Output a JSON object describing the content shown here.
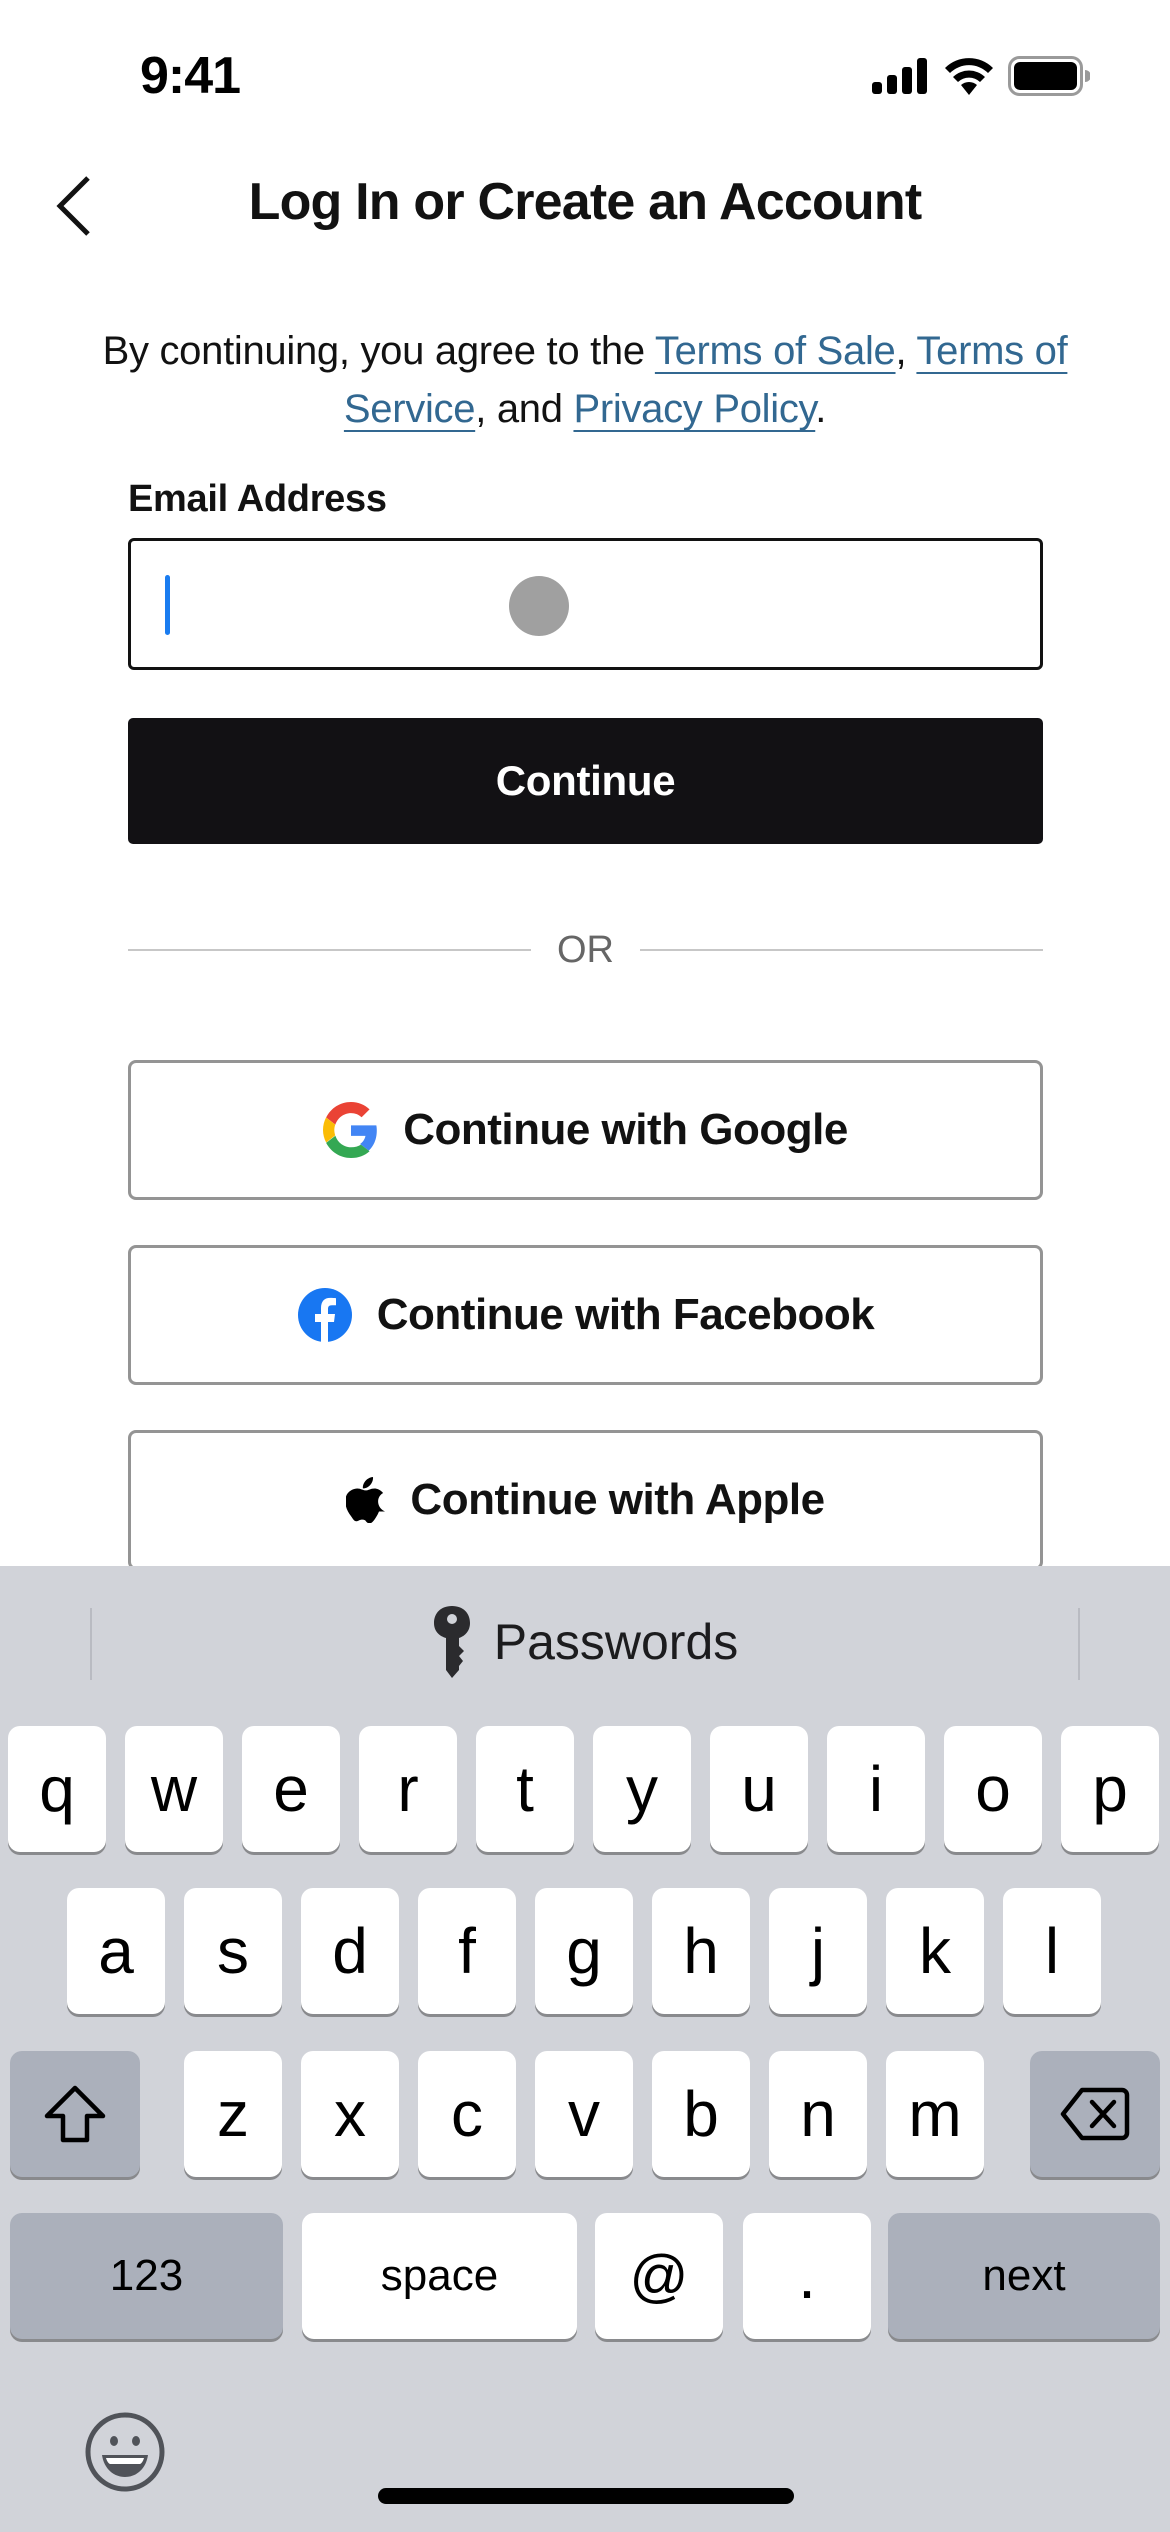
{
  "status_bar": {
    "time": "9:41",
    "icons": [
      "cellular-signal-icon",
      "wifi-icon",
      "battery-icon"
    ]
  },
  "header": {
    "back_icon": "chevron-left-icon",
    "title": "Log In or Create an Account"
  },
  "terms": {
    "prefix": "By continuing, you agree to the ",
    "terms_of_sale": "Terms of Sale",
    "sep1": ", ",
    "terms_of_service": "Terms of Service",
    "sep2": ", and ",
    "privacy_policy": "Privacy Policy",
    "suffix": ".",
    "link_color": "#326891"
  },
  "email": {
    "label": "Email Address",
    "value": "",
    "placeholder": ""
  },
  "continue_button": {
    "label": "Continue"
  },
  "divider": {
    "label": "OR"
  },
  "social": {
    "google": {
      "label": "Continue with Google",
      "icon": "google-icon"
    },
    "facebook": {
      "label": "Continue with Facebook",
      "icon": "facebook-icon"
    },
    "apple": {
      "label": "Continue with Apple",
      "icon": "apple-icon"
    }
  },
  "keyboard": {
    "suggestion": {
      "label": "Passwords",
      "icon": "key-icon"
    },
    "row1": [
      "q",
      "w",
      "e",
      "r",
      "t",
      "y",
      "u",
      "i",
      "o",
      "p"
    ],
    "row2": [
      "a",
      "s",
      "d",
      "f",
      "g",
      "h",
      "j",
      "k",
      "l"
    ],
    "row3": [
      "z",
      "x",
      "c",
      "v",
      "b",
      "n",
      "m"
    ],
    "shift_icon": "shift-icon",
    "delete_icon": "delete-icon",
    "numbers_label": "123",
    "space_label": "space",
    "at_label": "@",
    "dot_label": ".",
    "next_label": "next",
    "emoji_icon": "emoji-icon"
  }
}
